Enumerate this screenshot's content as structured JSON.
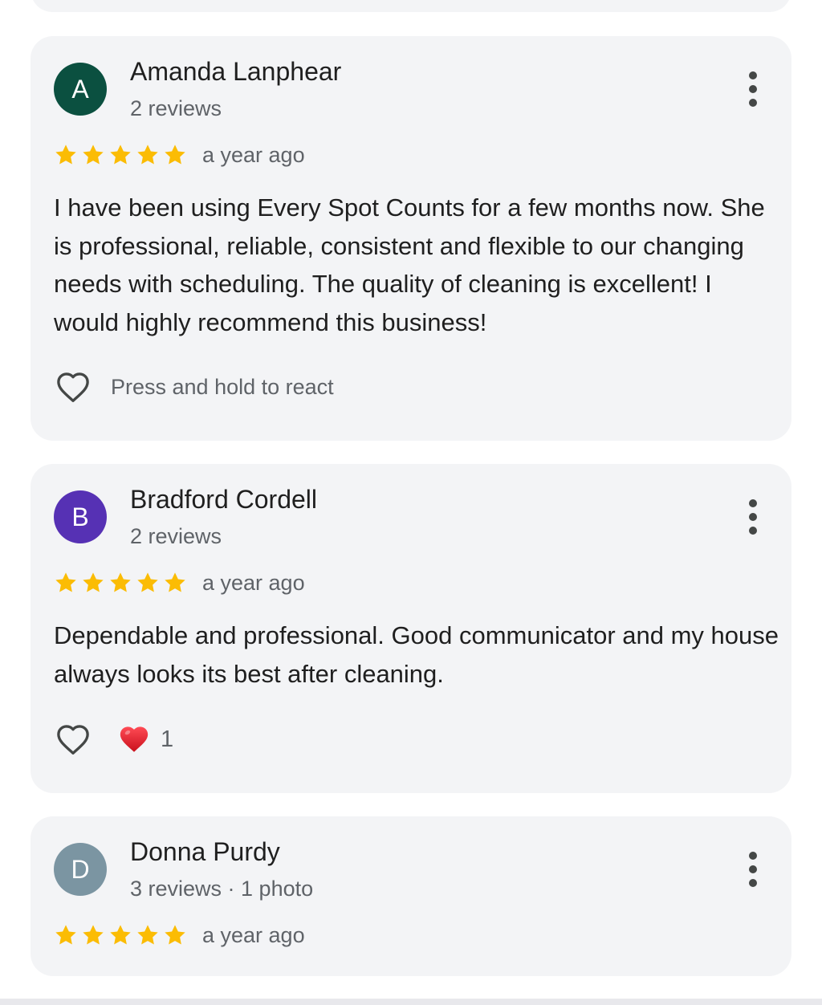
{
  "colors": {
    "card_bg": "#f3f4f6",
    "star": "#fbbc04",
    "text_primary": "#1f1f1f",
    "text_secondary": "#5f6368",
    "reaction_heart": "#e3202c"
  },
  "reviews": [
    {
      "avatar_letter": "A",
      "avatar_color": "#0b5040",
      "name": "Amanda Lanphear",
      "meta": "2 reviews",
      "rating": 5,
      "date": "a year ago",
      "text": "I have been using Every Spot Counts for a few months now. She is professional, reliable, consistent and flexible to our changing needs with scheduling. The quality of cleaning is excellent! I would highly recommend this business!",
      "react_hint": "Press and hold to react",
      "icons": {
        "like": "heart-outline-icon",
        "menu": "more-vert-icon"
      }
    },
    {
      "avatar_letter": "B",
      "avatar_color": "#5631b4",
      "name": "Bradford Cordell",
      "meta": "2 reviews",
      "rating": 5,
      "date": "a year ago",
      "text": "Dependable and professional. Good communicator and my house always looks its best after cleaning.",
      "reaction_count": "1",
      "icons": {
        "like": "heart-outline-icon",
        "reaction": "red-heart-icon",
        "menu": "more-vert-icon"
      }
    },
    {
      "avatar_letter": "D",
      "avatar_color": "#7b95a2",
      "name": "Donna Purdy",
      "meta": "3 reviews · 1 photo",
      "rating": 5,
      "date": "a year ago",
      "icons": {
        "menu": "more-vert-icon"
      }
    }
  ]
}
